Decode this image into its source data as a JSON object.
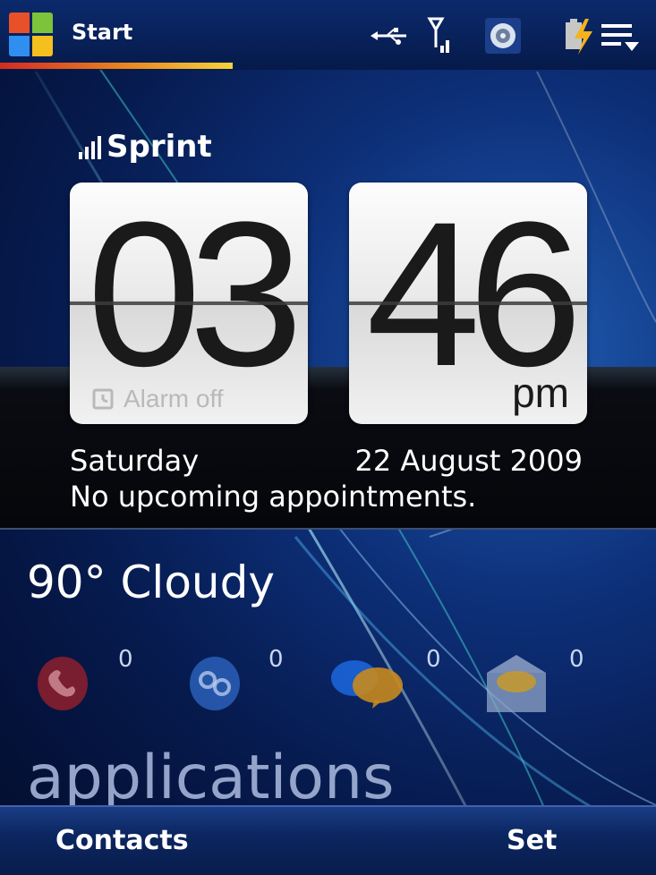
{
  "header": {
    "start_label": "Start",
    "icons": [
      "windows-logo",
      "usb-connection-icon",
      "signal-antenna-icon",
      "volume-icon",
      "battery-charging-menu-icon"
    ]
  },
  "carrier": "Sprint",
  "clock": {
    "hours": "03",
    "minutes": "46",
    "ampm": "pm",
    "alarm_status": "Alarm off"
  },
  "date": {
    "day": "Saturday",
    "full_date": "22 August 2009"
  },
  "appointments": "No upcoming appointments.",
  "weather": "90° Cloudy",
  "notifications": [
    {
      "icon": "missed-call-icon",
      "count": "0"
    },
    {
      "icon": "voicemail-icon",
      "count": "0"
    },
    {
      "icon": "text-message-icon",
      "count": "0"
    },
    {
      "icon": "email-icon",
      "count": "0"
    }
  ],
  "section_label": "applications",
  "softkeys": {
    "left": "Contacts",
    "right": "Set"
  },
  "colors": {
    "background": "#061a4d",
    "start_underline": "#e97f1f"
  }
}
